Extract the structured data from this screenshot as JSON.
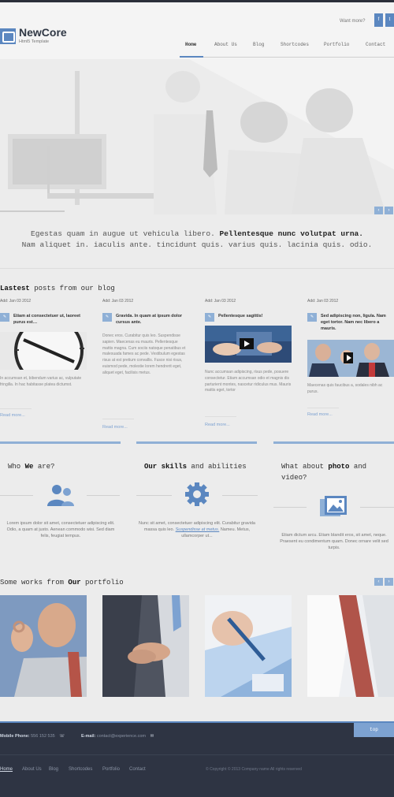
{
  "brand": {
    "name": "NewCore",
    "subtitle": "Html5 Template"
  },
  "header": {
    "want_more": "Want more?",
    "social": [
      {
        "icon": "facebook-icon",
        "glyph": "f"
      },
      {
        "icon": "twitter-icon",
        "glyph": "t"
      }
    ],
    "nav": [
      {
        "label": "Home",
        "active": true
      },
      {
        "label": "About Us"
      },
      {
        "label": "Blog"
      },
      {
        "label": "Shortcodes"
      },
      {
        "label": "Portfolio"
      },
      {
        "label": "Contact"
      }
    ]
  },
  "hero": {
    "prev": "‹",
    "next": "›"
  },
  "tagline": {
    "part1": "Egestas quam in augue ut vehicula libero.",
    "part1_bold": "Pellentesque nunc volutpat urna.",
    "line2": "Nam aliquet in. iaculis ante. tincidunt quis. varius quis. lacinia quis. odio."
  },
  "blog": {
    "title_bold": "Lastest",
    "title_rest": "posts from our blog",
    "posts": [
      {
        "date": "Add: Jan 03 2012",
        "title": "Etiam at consectetuer ut, laoreet purus est…",
        "text": "In accumsan et, bibendum varius ac, vulputate fringilla. In hac habitasse platea dictumst.",
        "more": "Read more..."
      },
      {
        "date": "Add: Jan 03 2012",
        "title": "Gravida. In quam at ipsum dolor cursus ante.",
        "text": "Donec eros. Curabitur quis leo. Suspendisse sapien. Maecenas eu mauris. Pellentesque mattis magna. Cum sociis natoque penatibus et malesuada fames ac pede. Vestibulum egestas risus at est pretium convallis. Fusce nisi risus, euismod pede, molestie lorem hendrerit eget, aliquet eget, facilisis metus.",
        "more": "Read more..."
      },
      {
        "date": "Add: Jan 03 2012",
        "title": "Pellentesque sagittis!",
        "text": "Nunc accumsan adipiscing, risus pede, posuere consectetur. Etiam accumsan odio et magnis dis parturient montes, nascetur ridiculus mus. Mauris mattis eget, tortor",
        "more": "Read more..."
      },
      {
        "date": "Add: Jan 03 2012",
        "title": "Sed adipiscing non, ligula. Nam eget tortor. Nam nec libero a mauris.",
        "text": "Maecenas quis faucibus a, sodales nibh ac purus.",
        "more": "Read more..."
      }
    ]
  },
  "features": [
    {
      "title_pre": "Who",
      "title_bold": "We",
      "title_post": "are?",
      "text": "Lorem ipsum dolor sit amet, consectetuer adipiscing elit. Odio, a quam at justo. Aenean commodo wisi. Sed diam felis, feugiat tempus.",
      "icon": "users-icon"
    },
    {
      "title_pre": "",
      "title_bold": "Our skills",
      "title_post": "and abilities",
      "text_a": "Nunc sit amet, consectetuer adipiscing elit. Curabitur gravida massa quis leo.",
      "text_link": "Suspendisse at metus.",
      "text_b": "Nameu. Metus, ullamcorper ut...",
      "icon": "gear-icon"
    },
    {
      "title_pre": "What about",
      "title_bold": "photo",
      "title_post": "and video?",
      "text": "Etiam dictum arcu. Etiam blandit eros, sit amet, neque. Praesent eu condimentum quam. Donec ornare velit sed turpis.",
      "icon": "photo-gallery-icon"
    }
  ],
  "portfolio": {
    "title_pre": "Some works from",
    "title_bold": "Our",
    "title_post": "portfolio",
    "prev": "‹",
    "next": "›"
  },
  "footer": {
    "top": "top",
    "phone_label": "Mobile Phone:",
    "phone": "556 152 535",
    "email_label": "E-mail:",
    "email": "contact@experience.com",
    "links": [
      {
        "label": "Home",
        "active": true
      },
      {
        "label": "About Us"
      },
      {
        "label": "Blog"
      },
      {
        "label": "Shortcodes"
      },
      {
        "label": "Portfolio"
      },
      {
        "label": "Contact"
      }
    ],
    "copyright": "© Copyright © 2013 Company name All rights reserved"
  },
  "colors": {
    "accent": "#5b87c0",
    "accent_light": "#8fb0d6",
    "footer_bg": "#2e3443"
  }
}
